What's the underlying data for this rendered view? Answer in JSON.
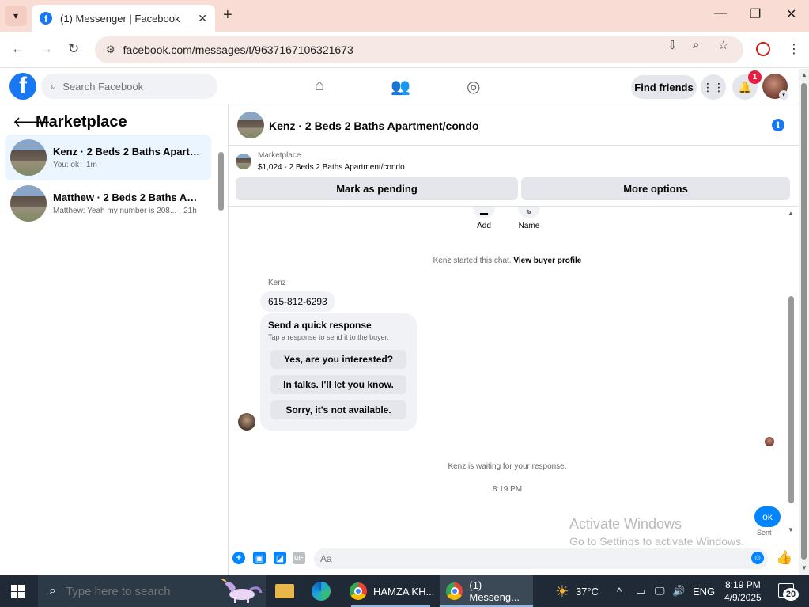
{
  "browser": {
    "tab_title": "(1) Messenger | Facebook",
    "url": "facebook.com/messages/t/9637167106321673"
  },
  "facebook_header": {
    "search_placeholder": "Search Facebook",
    "find_friends_label": "Find friends",
    "notification_count": "1"
  },
  "left_panel": {
    "title": "Marketplace",
    "conversations": [
      {
        "title": "Kenz · 2 Beds 2 Baths Apartmen...",
        "subtitle": "You: ok · 1m"
      },
      {
        "title": "Matthew · 2 Beds 2 Baths Apart...",
        "subtitle": "Matthew: Yeah my number is 208... · 21h"
      }
    ]
  },
  "chat": {
    "title": "Kenz · 2 Beds 2 Baths Apartment/condo",
    "listing": {
      "label": "Marketplace",
      "price_line": "$1,024 - 2 Beds 2 Baths Apartment/condo",
      "mark_pending_label": "Mark as pending",
      "more_options_label": "More options"
    },
    "actions": {
      "add_label": "Add",
      "name_label": "Name"
    },
    "started_text": "Kenz started this chat.",
    "view_profile_label": "View buyer profile",
    "sender_name": "Kenz",
    "phone_message": "615-812-6293",
    "quick_response": {
      "title": "Send a quick response",
      "subtitle": "Tap a response to send it to the buyer.",
      "options": [
        "Yes, are you interested?",
        "In talks. I'll let you know.",
        "Sorry, it's not available."
      ]
    },
    "waiting_text": "Kenz is waiting for your response.",
    "timestamp": "8:19 PM",
    "my_message": "ok",
    "sent_label": "Sent",
    "composer_placeholder": "Aa"
  },
  "watermark": {
    "line1": "Activate Windows",
    "line2": "Go to Settings to activate Windows."
  },
  "taskbar": {
    "search_placeholder": "Type here to search",
    "app1_label": "HAMZA KH...",
    "app2_label": "(1) Messeng...",
    "temperature": "37°C",
    "language": "ENG",
    "time": "8:19 PM",
    "date": "4/9/2025",
    "notifications": "20"
  },
  "colors": {
    "facebook_blue": "#1877f2",
    "messenger_blue": "#0084ff",
    "tab_strip": "#f9dcd3",
    "taskbar": "#1f2a36"
  }
}
